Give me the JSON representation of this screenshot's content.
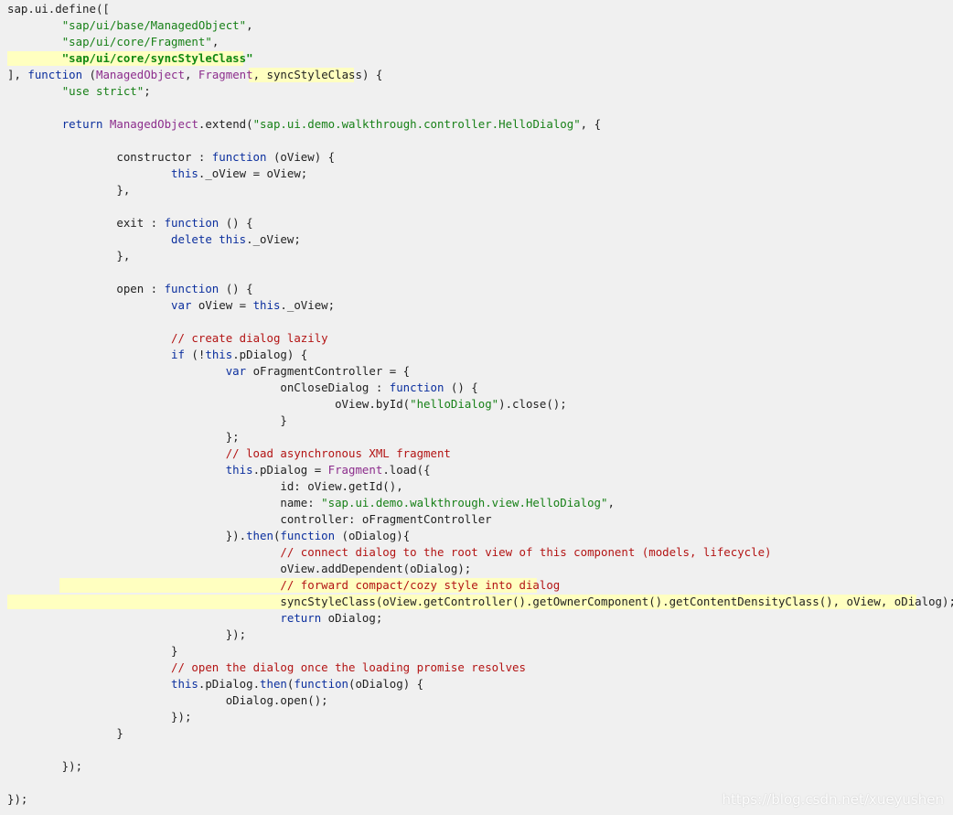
{
  "code": {
    "language": "javascript",
    "lines": [
      [
        {
          "t": "sap.ui.define(["
        }
      ],
      [
        {
          "t": "        "
        },
        {
          "t": "\"sap/ui/base/ManagedObject\"",
          "c": "str"
        },
        {
          "t": ","
        }
      ],
      [
        {
          "t": "        "
        },
        {
          "t": "\"sap/ui/core/Fragment\"",
          "c": "str"
        },
        {
          "t": ","
        }
      ],
      [
        {
          "t": "        "
        },
        {
          "t": "\"sap/ui/core/syncStyleClass\"",
          "c": "hlstr"
        }
      ],
      [
        {
          "t": "], "
        },
        {
          "t": "function",
          "c": "kw"
        },
        {
          "t": " ("
        },
        {
          "t": "ManagedObject",
          "c": "fn"
        },
        {
          "t": ", "
        },
        {
          "t": "Fragment",
          "c": "fn"
        },
        {
          "t": ", syncStyleClass) {"
        }
      ],
      [
        {
          "t": "        "
        },
        {
          "t": "\"use strict\"",
          "c": "str"
        },
        {
          "t": ";"
        }
      ],
      [],
      [
        {
          "t": "        "
        },
        {
          "t": "return",
          "c": "kw"
        },
        {
          "t": " "
        },
        {
          "t": "ManagedObject",
          "c": "fn"
        },
        {
          "t": ".extend("
        },
        {
          "t": "\"sap.ui.demo.walkthrough.controller.HelloDialog\"",
          "c": "str"
        },
        {
          "t": ", {"
        }
      ],
      [],
      [
        {
          "t": "                constructor : "
        },
        {
          "t": "function",
          "c": "kw"
        },
        {
          "t": " (oView) {"
        }
      ],
      [
        {
          "t": "                        "
        },
        {
          "t": "this",
          "c": "kw"
        },
        {
          "t": "._oView = oView;"
        }
      ],
      [
        {
          "t": "                },"
        }
      ],
      [],
      [
        {
          "t": "                exit : "
        },
        {
          "t": "function",
          "c": "kw"
        },
        {
          "t": " () {"
        }
      ],
      [
        {
          "t": "                        "
        },
        {
          "t": "delete",
          "c": "kw"
        },
        {
          "t": " "
        },
        {
          "t": "this",
          "c": "kw"
        },
        {
          "t": "._oView;"
        }
      ],
      [
        {
          "t": "                },"
        }
      ],
      [],
      [
        {
          "t": "                open : "
        },
        {
          "t": "function",
          "c": "kw"
        },
        {
          "t": " () {"
        }
      ],
      [
        {
          "t": "                        "
        },
        {
          "t": "var",
          "c": "kw"
        },
        {
          "t": " oView = "
        },
        {
          "t": "this",
          "c": "kw"
        },
        {
          "t": "._oView;"
        }
      ],
      [],
      [
        {
          "t": "                        "
        },
        {
          "t": "// create dialog lazily",
          "c": "cm"
        }
      ],
      [
        {
          "t": "                        "
        },
        {
          "t": "if",
          "c": "kw"
        },
        {
          "t": " (!"
        },
        {
          "t": "this",
          "c": "kw"
        },
        {
          "t": ".pDialog) {"
        }
      ],
      [
        {
          "t": "                                "
        },
        {
          "t": "var",
          "c": "kw"
        },
        {
          "t": " oFragmentController = {"
        }
      ],
      [
        {
          "t": "                                        onCloseDialog : "
        },
        {
          "t": "function",
          "c": "kw"
        },
        {
          "t": " () {"
        }
      ],
      [
        {
          "t": "                                                oView.byId("
        },
        {
          "t": "\"helloDialog\"",
          "c": "str"
        },
        {
          "t": ").close();"
        }
      ],
      [
        {
          "t": "                                        }"
        }
      ],
      [
        {
          "t": "                                };"
        }
      ],
      [
        {
          "t": "                                "
        },
        {
          "t": "// load asynchronous XML fragment",
          "c": "cm"
        }
      ],
      [
        {
          "t": "                                "
        },
        {
          "t": "this",
          "c": "kw"
        },
        {
          "t": ".pDialog = "
        },
        {
          "t": "Fragment",
          "c": "fn"
        },
        {
          "t": ".load({"
        }
      ],
      [
        {
          "t": "                                        id: oView.getId(),"
        }
      ],
      [
        {
          "t": "                                        name: "
        },
        {
          "t": "\"sap.ui.demo.walkthrough.view.HelloDialog\"",
          "c": "str"
        },
        {
          "t": ","
        }
      ],
      [
        {
          "t": "                                        controller: oFragmentController"
        }
      ],
      [
        {
          "t": "                                })."
        },
        {
          "t": "then",
          "c": "kw"
        },
        {
          "t": "("
        },
        {
          "t": "function",
          "c": "kw"
        },
        {
          "t": " (oDialog){"
        }
      ],
      [
        {
          "t": "                                        "
        },
        {
          "t": "// connect dialog to the root view of this component (models, lifecycle)",
          "c": "cm"
        }
      ],
      [
        {
          "t": "                                        oView.addDependent(oDialog);"
        }
      ],
      [
        {
          "t": "                                        "
        },
        {
          "t": "// forward compact/cozy style into dialog",
          "c": "cm"
        }
      ],
      [
        {
          "t": "                                        syncStyleClass(oView.getController().getOwnerComponent().getContentDensityClass(), oView, oDialog);"
        }
      ],
      [
        {
          "t": "                                        "
        },
        {
          "t": "return",
          "c": "kw"
        },
        {
          "t": " oDialog;"
        }
      ],
      [
        {
          "t": "                                });"
        }
      ],
      [
        {
          "t": "                        }"
        }
      ],
      [
        {
          "t": "                        "
        },
        {
          "t": "// open the dialog once the loading promise resolves",
          "c": "cm"
        }
      ],
      [
        {
          "t": "                        "
        },
        {
          "t": "this",
          "c": "kw"
        },
        {
          "t": ".pDialog."
        },
        {
          "t": "then",
          "c": "kw"
        },
        {
          "t": "("
        },
        {
          "t": "function",
          "c": "kw"
        },
        {
          "t": "(oDialog) {"
        }
      ],
      [
        {
          "t": "                                oDialog.open();"
        }
      ],
      [
        {
          "t": "                        });"
        }
      ],
      [
        {
          "t": "                }"
        }
      ],
      [],
      [
        {
          "t": "        });"
        }
      ],
      [],
      [
        {
          "t": "});"
        }
      ]
    ]
  },
  "watermark": "https://blog.csdn.net/xueyushen",
  "colors": {
    "background": "#f0f0f0",
    "highlight": "#ffffc0",
    "keyword": "#0b2f9e",
    "string": "#178017",
    "comment": "#b31414",
    "identifier": "#8c2d8c"
  }
}
